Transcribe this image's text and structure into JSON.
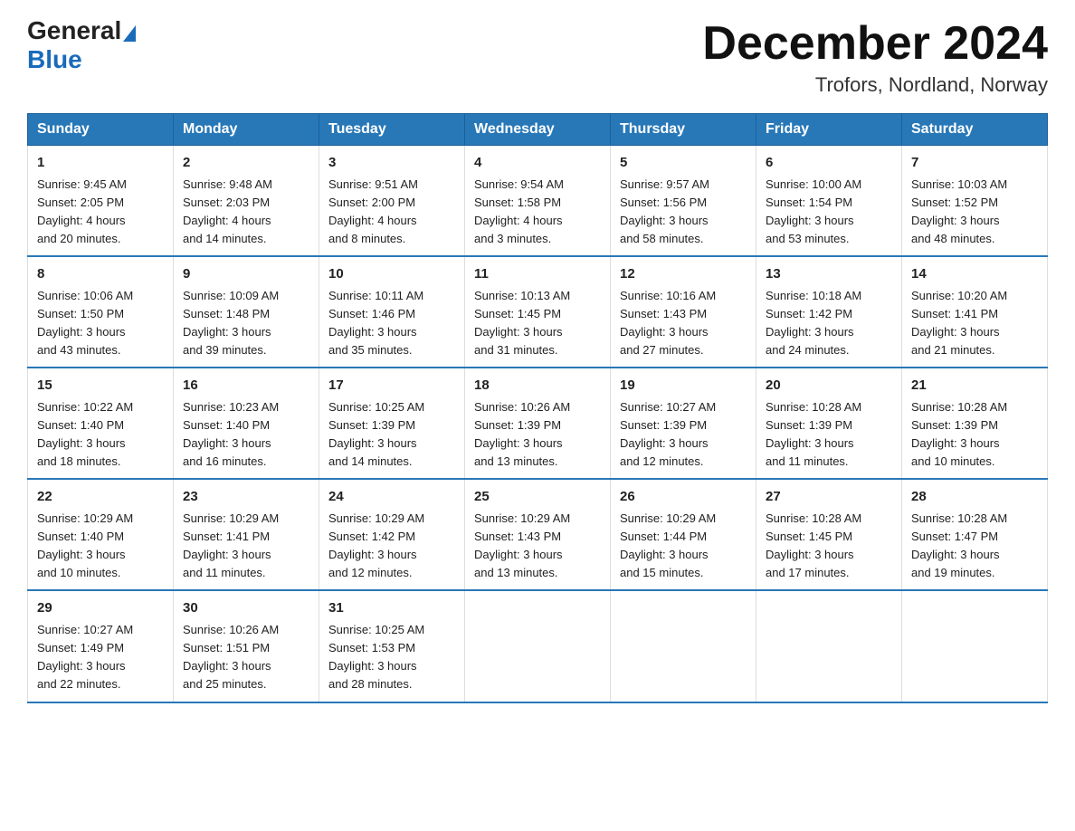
{
  "logo": {
    "general": "General",
    "blue": "Blue"
  },
  "title": "December 2024",
  "subtitle": "Trofors, Nordland, Norway",
  "header_days": [
    "Sunday",
    "Monday",
    "Tuesday",
    "Wednesday",
    "Thursday",
    "Friday",
    "Saturday"
  ],
  "weeks": [
    [
      {
        "day": "1",
        "sunrise": "9:45 AM",
        "sunset": "2:05 PM",
        "daylight": "4 hours and 20 minutes."
      },
      {
        "day": "2",
        "sunrise": "9:48 AM",
        "sunset": "2:03 PM",
        "daylight": "4 hours and 14 minutes."
      },
      {
        "day": "3",
        "sunrise": "9:51 AM",
        "sunset": "2:00 PM",
        "daylight": "4 hours and 8 minutes."
      },
      {
        "day": "4",
        "sunrise": "9:54 AM",
        "sunset": "1:58 PM",
        "daylight": "4 hours and 3 minutes."
      },
      {
        "day": "5",
        "sunrise": "9:57 AM",
        "sunset": "1:56 PM",
        "daylight": "3 hours and 58 minutes."
      },
      {
        "day": "6",
        "sunrise": "10:00 AM",
        "sunset": "1:54 PM",
        "daylight": "3 hours and 53 minutes."
      },
      {
        "day": "7",
        "sunrise": "10:03 AM",
        "sunset": "1:52 PM",
        "daylight": "3 hours and 48 minutes."
      }
    ],
    [
      {
        "day": "8",
        "sunrise": "10:06 AM",
        "sunset": "1:50 PM",
        "daylight": "3 hours and 43 minutes."
      },
      {
        "day": "9",
        "sunrise": "10:09 AM",
        "sunset": "1:48 PM",
        "daylight": "3 hours and 39 minutes."
      },
      {
        "day": "10",
        "sunrise": "10:11 AM",
        "sunset": "1:46 PM",
        "daylight": "3 hours and 35 minutes."
      },
      {
        "day": "11",
        "sunrise": "10:13 AM",
        "sunset": "1:45 PM",
        "daylight": "3 hours and 31 minutes."
      },
      {
        "day": "12",
        "sunrise": "10:16 AM",
        "sunset": "1:43 PM",
        "daylight": "3 hours and 27 minutes."
      },
      {
        "day": "13",
        "sunrise": "10:18 AM",
        "sunset": "1:42 PM",
        "daylight": "3 hours and 24 minutes."
      },
      {
        "day": "14",
        "sunrise": "10:20 AM",
        "sunset": "1:41 PM",
        "daylight": "3 hours and 21 minutes."
      }
    ],
    [
      {
        "day": "15",
        "sunrise": "10:22 AM",
        "sunset": "1:40 PM",
        "daylight": "3 hours and 18 minutes."
      },
      {
        "day": "16",
        "sunrise": "10:23 AM",
        "sunset": "1:40 PM",
        "daylight": "3 hours and 16 minutes."
      },
      {
        "day": "17",
        "sunrise": "10:25 AM",
        "sunset": "1:39 PM",
        "daylight": "3 hours and 14 minutes."
      },
      {
        "day": "18",
        "sunrise": "10:26 AM",
        "sunset": "1:39 PM",
        "daylight": "3 hours and 13 minutes."
      },
      {
        "day": "19",
        "sunrise": "10:27 AM",
        "sunset": "1:39 PM",
        "daylight": "3 hours and 12 minutes."
      },
      {
        "day": "20",
        "sunrise": "10:28 AM",
        "sunset": "1:39 PM",
        "daylight": "3 hours and 11 minutes."
      },
      {
        "day": "21",
        "sunrise": "10:28 AM",
        "sunset": "1:39 PM",
        "daylight": "3 hours and 10 minutes."
      }
    ],
    [
      {
        "day": "22",
        "sunrise": "10:29 AM",
        "sunset": "1:40 PM",
        "daylight": "3 hours and 10 minutes."
      },
      {
        "day": "23",
        "sunrise": "10:29 AM",
        "sunset": "1:41 PM",
        "daylight": "3 hours and 11 minutes."
      },
      {
        "day": "24",
        "sunrise": "10:29 AM",
        "sunset": "1:42 PM",
        "daylight": "3 hours and 12 minutes."
      },
      {
        "day": "25",
        "sunrise": "10:29 AM",
        "sunset": "1:43 PM",
        "daylight": "3 hours and 13 minutes."
      },
      {
        "day": "26",
        "sunrise": "10:29 AM",
        "sunset": "1:44 PM",
        "daylight": "3 hours and 15 minutes."
      },
      {
        "day": "27",
        "sunrise": "10:28 AM",
        "sunset": "1:45 PM",
        "daylight": "3 hours and 17 minutes."
      },
      {
        "day": "28",
        "sunrise": "10:28 AM",
        "sunset": "1:47 PM",
        "daylight": "3 hours and 19 minutes."
      }
    ],
    [
      {
        "day": "29",
        "sunrise": "10:27 AM",
        "sunset": "1:49 PM",
        "daylight": "3 hours and 22 minutes."
      },
      {
        "day": "30",
        "sunrise": "10:26 AM",
        "sunset": "1:51 PM",
        "daylight": "3 hours and 25 minutes."
      },
      {
        "day": "31",
        "sunrise": "10:25 AM",
        "sunset": "1:53 PM",
        "daylight": "3 hours and 28 minutes."
      },
      null,
      null,
      null,
      null
    ]
  ],
  "labels": {
    "sunrise": "Sunrise:",
    "sunset": "Sunset:",
    "daylight": "Daylight:"
  }
}
